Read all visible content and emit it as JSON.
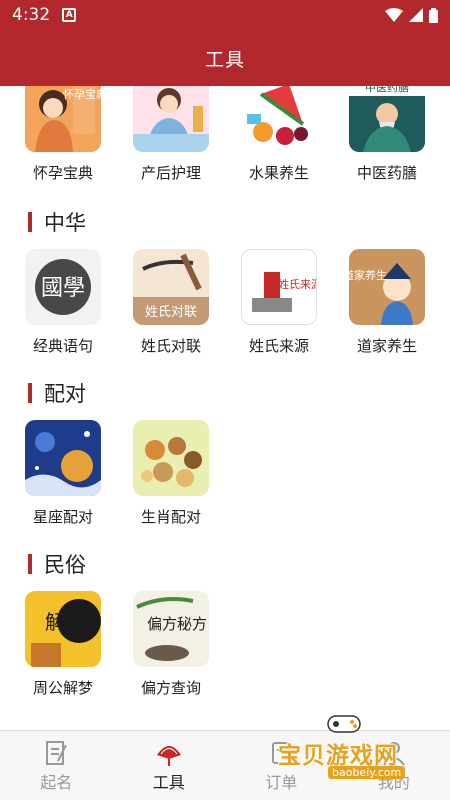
{
  "status": {
    "time": "4:32",
    "notification": "A"
  },
  "app_bar": {
    "title": "工具"
  },
  "row0": [
    {
      "label": "怀孕宝典",
      "art": "怀孕宝典"
    },
    {
      "label": "产后护理",
      "art": ""
    },
    {
      "label": "水果养生",
      "art": ""
    },
    {
      "label": "中医药膳",
      "art": "中医药膳"
    }
  ],
  "sections": [
    {
      "title": "中华",
      "items": [
        {
          "label": "经典语句",
          "art": "國學"
        },
        {
          "label": "姓氏对联",
          "art": "姓氏对联"
        },
        {
          "label": "姓氏来源",
          "art": "姓氏来源"
        },
        {
          "label": "道家养生",
          "art": "道家养生"
        }
      ]
    },
    {
      "title": "配对",
      "items": [
        {
          "label": "星座配对",
          "art": ""
        },
        {
          "label": "生肖配对",
          "art": ""
        }
      ]
    },
    {
      "title": "民俗",
      "items": [
        {
          "label": "周公解梦",
          "art": "解夢"
        },
        {
          "label": "偏方查询",
          "art": "偏方秘方"
        }
      ]
    }
  ],
  "bottom_nav": [
    {
      "label": "起名",
      "icon": "document-pen-icon",
      "active": false
    },
    {
      "label": "工具",
      "icon": "fan-icon",
      "active": true
    },
    {
      "label": "订单",
      "icon": "order-icon",
      "active": false
    },
    {
      "label": "我的",
      "icon": "person-icon",
      "active": false
    }
  ],
  "watermark": {
    "text": "宝贝游戏网",
    "url": "baobeiy.com"
  },
  "colors": {
    "primary": "#b3282d",
    "watermark": "#e6a21c"
  }
}
